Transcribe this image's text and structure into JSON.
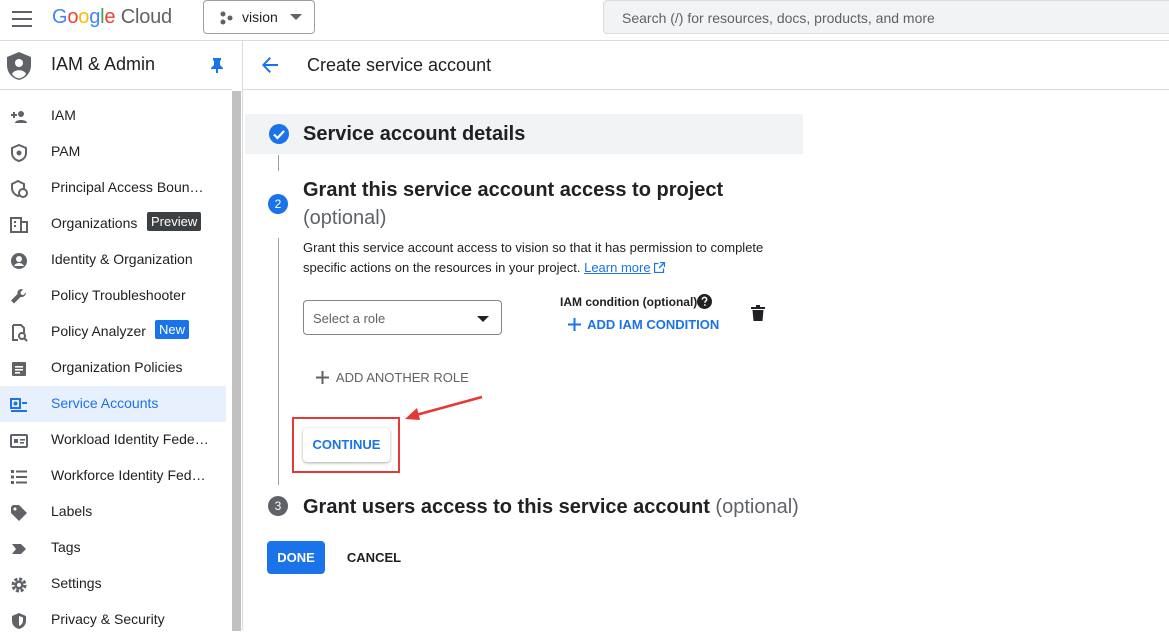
{
  "topbar": {
    "logo_google": "Google",
    "logo_cloud": "Cloud",
    "project_name": "vision",
    "search_placeholder": "Search (/) for resources, docs, products, and more"
  },
  "sidebar": {
    "title": "IAM & Admin",
    "items": [
      {
        "label": "IAM",
        "icon": "person-add-icon"
      },
      {
        "label": "PAM",
        "icon": "shield-icon"
      },
      {
        "label": "Principal Access Boun…",
        "icon": "principal-access-icon"
      },
      {
        "label": "Organizations",
        "icon": "organization-icon",
        "badge": "Preview"
      },
      {
        "label": "Identity & Organization",
        "icon": "account-circle-icon"
      },
      {
        "label": "Policy Troubleshooter",
        "icon": "wrench-icon"
      },
      {
        "label": "Policy Analyzer",
        "icon": "policy-analyzer-icon",
        "badge": "New"
      },
      {
        "label": "Organization Policies",
        "icon": "list-document-icon"
      },
      {
        "label": "Service Accounts",
        "icon": "service-account-icon",
        "active": true
      },
      {
        "label": "Workload Identity Fede…",
        "icon": "id-card-icon"
      },
      {
        "label": "Workforce Identity Fed…",
        "icon": "list-icon"
      },
      {
        "label": "Labels",
        "icon": "label-icon"
      },
      {
        "label": "Tags",
        "icon": "tag-icon"
      },
      {
        "label": "Settings",
        "icon": "gear-icon"
      },
      {
        "label": "Privacy & Security",
        "icon": "privacy-shield-icon"
      }
    ]
  },
  "header": {
    "page_title": "Create service account"
  },
  "steps": {
    "step1": {
      "title": "Service account details"
    },
    "step2": {
      "number": "2",
      "title": "Grant this service account access to project",
      "optional": "(optional)",
      "description": "Grant this service account access to vision so that it has permission to complete specific actions on the resources in your project.",
      "learn_more": "Learn more",
      "role_placeholder": "Select a role",
      "iam_condition_label": "IAM condition (optional)",
      "add_iam_condition": "ADD IAM CONDITION",
      "add_another_role": "ADD ANOTHER ROLE",
      "continue_label": "CONTINUE"
    },
    "step3": {
      "number": "3",
      "title": "Grant users access to this service account",
      "optional": "(optional)"
    }
  },
  "actions": {
    "done_label": "DONE",
    "cancel_label": "CANCEL"
  },
  "colors": {
    "accent": "#1a73e8",
    "highlight": "#e53935"
  }
}
